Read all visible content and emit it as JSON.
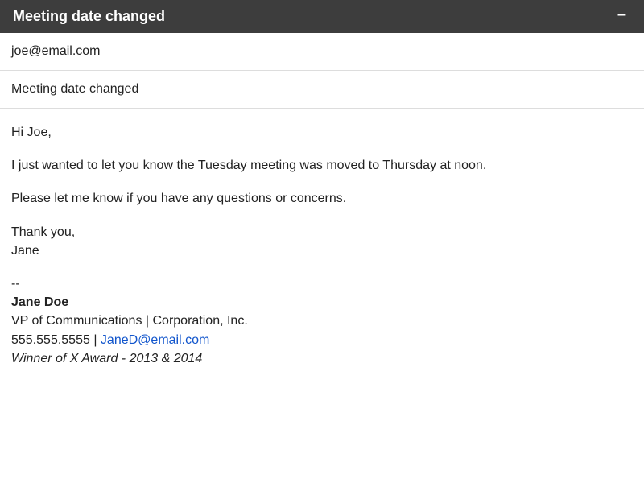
{
  "titlebar": {
    "title": "Meeting date changed"
  },
  "to": "joe@email.com",
  "subject": "Meeting date changed",
  "body": {
    "greeting": "Hi Joe,",
    "p1": "I just wanted to let you know the Tuesday meeting was moved to Thursday at noon.",
    "p2": "Please let me know if you have any questions or concerns.",
    "closing1": "Thank you,",
    "closing2": "Jane"
  },
  "signature": {
    "sep": "--",
    "name": "Jane Doe",
    "title": "VP of Communications | Corporation, Inc.",
    "phone": "555.555.5555",
    "contact_sep": " | ",
    "email": "JaneD@email.com",
    "award": "Winner of X Award - 2013 & 2014"
  }
}
